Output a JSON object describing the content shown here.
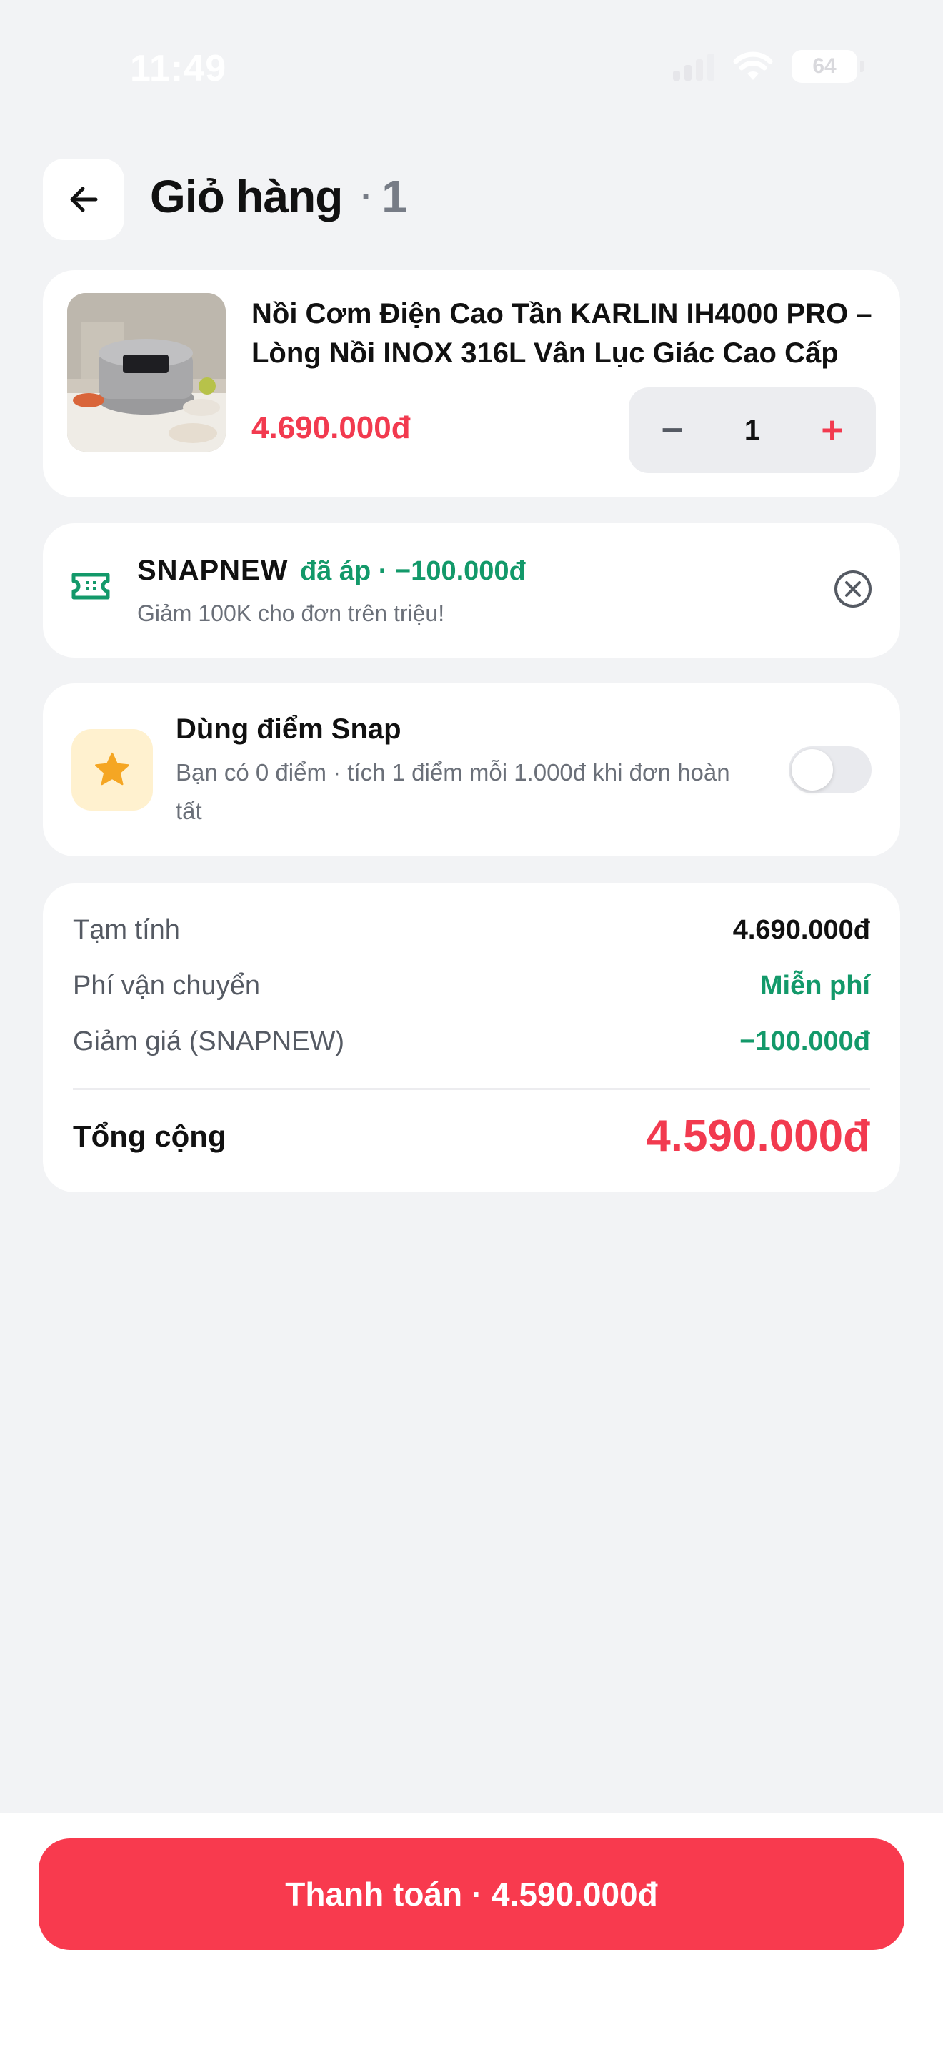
{
  "status_bar": {
    "time": "11:49",
    "battery": "64"
  },
  "header": {
    "title": "Giỏ hàng",
    "separator": "·",
    "count": "1"
  },
  "cart_item": {
    "name": "Nồi Cơm Điện Cao Tần KARLIN IH4000 PRO – Lòng Nồi INOX 316L Vân Lục Giác Cao Cấp",
    "price": "4.690.000đ",
    "quantity": "1",
    "minus_label": "−",
    "plus_label": "+"
  },
  "coupon": {
    "code": "SNAPNEW",
    "applied_text": "đã áp · −100.000đ",
    "description": "Giảm 100K cho đơn trên triệu!"
  },
  "points": {
    "title": "Dùng điểm Snap",
    "description": "Bạn có 0 điểm · tích 1 điểm mỗi 1.000đ khi đơn hoàn tất",
    "enabled": false
  },
  "summary": {
    "subtotal_label": "Tạm tính",
    "subtotal_value": "4.690.000đ",
    "shipping_label": "Phí vận chuyển",
    "shipping_value": "Miễn phí",
    "discount_label": "Giảm giá (SNAPNEW)",
    "discount_value": "−100.000đ",
    "total_label": "Tổng cộng",
    "total_value": "4.590.000đ"
  },
  "checkout": {
    "label": "Thanh toán · 4.590.000đ"
  },
  "colors": {
    "accent_red": "#f23a4f",
    "success_green": "#13996a",
    "background": "#f2f3f5"
  }
}
